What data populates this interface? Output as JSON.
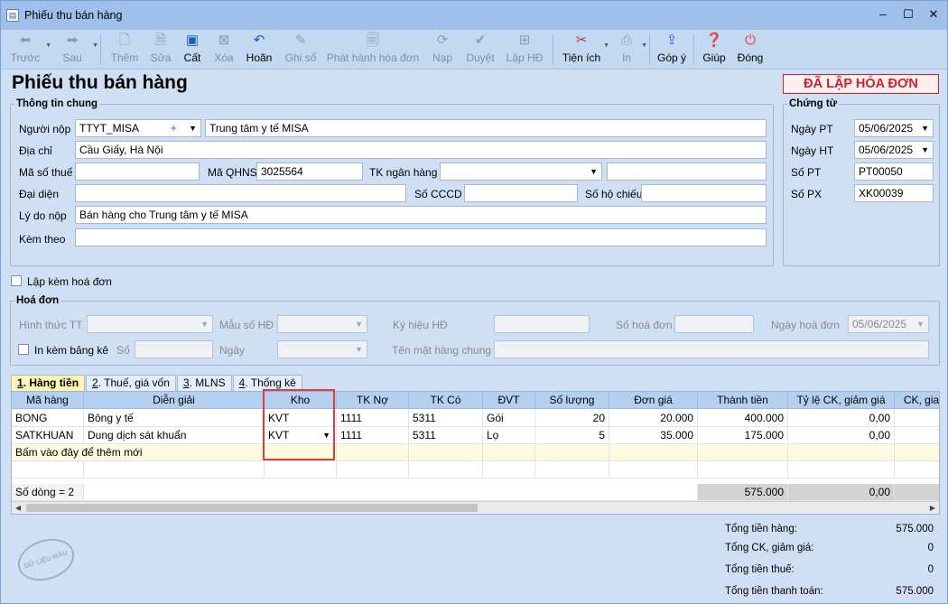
{
  "window": {
    "title": "Phiếu thu bán hàng",
    "controls": [
      "minimize",
      "maximize",
      "close"
    ]
  },
  "toolbar": {
    "items": [
      {
        "label": "Trước",
        "icon": "arrow-left-icon",
        "enabled": false
      },
      {
        "label": "Sau",
        "icon": "arrow-right-icon",
        "enabled": false
      },
      {
        "label": "Thêm",
        "icon": "add-doc-icon",
        "enabled": false
      },
      {
        "label": "Sửa",
        "icon": "edit-doc-icon",
        "enabled": false
      },
      {
        "label": "Cất",
        "icon": "save-icon",
        "enabled": true
      },
      {
        "label": "Xóa",
        "icon": "delete-icon",
        "enabled": false
      },
      {
        "label": "Hoãn",
        "icon": "undo-icon",
        "enabled": true
      },
      {
        "label": "Ghi sổ",
        "icon": "pencil-icon",
        "enabled": false
      },
      {
        "label": "Phát hành hóa đơn",
        "icon": "invoice-icon",
        "enabled": false
      },
      {
        "label": "Nạp",
        "icon": "refresh-icon",
        "enabled": false
      },
      {
        "label": "Duyệt",
        "icon": "check-icon",
        "enabled": false
      },
      {
        "label": "Lập HĐ",
        "icon": "create-invoice-icon",
        "enabled": false
      },
      {
        "label": "Tiện ích",
        "icon": "tools-icon",
        "enabled": true
      },
      {
        "label": "In",
        "icon": "printer-icon",
        "enabled": false
      },
      {
        "label": "Góp ý",
        "icon": "feedback-icon",
        "enabled": true
      },
      {
        "label": "Giúp",
        "icon": "help-icon",
        "enabled": true
      },
      {
        "label": "Đóng",
        "icon": "power-icon",
        "enabled": true
      }
    ]
  },
  "page": {
    "title": "Phiếu thu bán hàng",
    "status_stamp": "ĐÃ LẬP HÓA ĐƠN"
  },
  "general": {
    "legend": "Thông tin chung",
    "payer_label": "Người nộp",
    "payer_code": "TTYT_MISA",
    "payer_name": "Trung tâm y tế MISA",
    "address_label": "Địa chỉ",
    "address": "Cầu Giấy, Hà Nội",
    "tax_label": "Mã số thuế",
    "tax": "",
    "qhns_label": "Mã QHNS",
    "qhns": "3025564",
    "bank_label": "TK ngân hàng",
    "bank": "",
    "bank_name": "",
    "rep_label": "Đại diện",
    "rep": "",
    "cccd_label": "Số CCCD",
    "cccd": "",
    "passport_label": "Số hộ chiếu",
    "passport": "",
    "reason_label": "Lý do nộp",
    "reason": "Bán hàng cho Trung tâm y tế MISA",
    "attach_label": "Kèm theo",
    "attach": ""
  },
  "voucher": {
    "legend": "Chứng từ",
    "date_pt_label": "Ngày PT",
    "date_pt": "05/06/2025",
    "date_ht_label": "Ngày HT",
    "date_ht": "05/06/2025",
    "no_pt_label": "Số PT",
    "no_pt": "PT00050",
    "no_px_label": "Số PX",
    "no_px": "XK00039"
  },
  "invoice_check": {
    "label": "Lập kèm hoá đơn",
    "checked": false
  },
  "invoice": {
    "legend": "Hoá đơn",
    "form_label": "Hình thức TT",
    "form": "",
    "template_label": "Mẫu số HĐ",
    "template": "",
    "symbol_label": "Ký hiệu HĐ",
    "symbol": "",
    "number_label": "Số hoá đơn",
    "number": "",
    "date_label": "Ngày hoá đơn",
    "date": "05/06/2025",
    "list_label": "In kèm bảng kê",
    "list_checked": false,
    "no_label": "Số",
    "no": "",
    "day_label": "Ngày",
    "day": "",
    "goods_label": "Tên mặt hàng chung",
    "goods": ""
  },
  "tabs": [
    {
      "num": "1",
      "label": ". Hàng tiền",
      "active": true
    },
    {
      "num": "2",
      "label": ". Thuế, giá vốn",
      "active": false
    },
    {
      "num": "3",
      "label": ". MLNS",
      "active": false
    },
    {
      "num": "4",
      "label": ". Thống kê",
      "active": false
    }
  ],
  "grid": {
    "columns": [
      "Mã hàng",
      "Diễn giải",
      "Kho",
      "TK Nợ",
      "TK Có",
      "ĐVT",
      "Số lượng",
      "Đơn giá",
      "Thành tiền",
      "Tỷ lệ CK, giảm giá",
      "CK, gia"
    ],
    "rows": [
      [
        "BONG",
        "Bông y tế",
        "KVT",
        "1111",
        "5311",
        "Gói",
        "20",
        "20.000",
        "400.000",
        "0,00",
        ""
      ],
      [
        "SATKHUAN",
        "Dung dịch sát khuẩn",
        "KVT",
        "1111",
        "5311",
        "Lọ",
        "5",
        "35.000",
        "175.000",
        "0,00",
        ""
      ]
    ],
    "add_row_text": "Bấm vào đây để thêm mới",
    "footer_count": "Số dòng = 2",
    "footer_total": "575.000",
    "footer_discount": "0,00"
  },
  "totals": [
    {
      "label": "Tổng tiền hàng:",
      "value": "575.000"
    },
    {
      "label": "Tổng CK, giảm giá:",
      "value": "0"
    },
    {
      "label": "Tổng tiền thuế:",
      "value": "0"
    },
    {
      "label": "Tổng tiền thanh toán:",
      "value": "575.000"
    }
  ],
  "watermark": "DỮ LIỆU MẪU"
}
